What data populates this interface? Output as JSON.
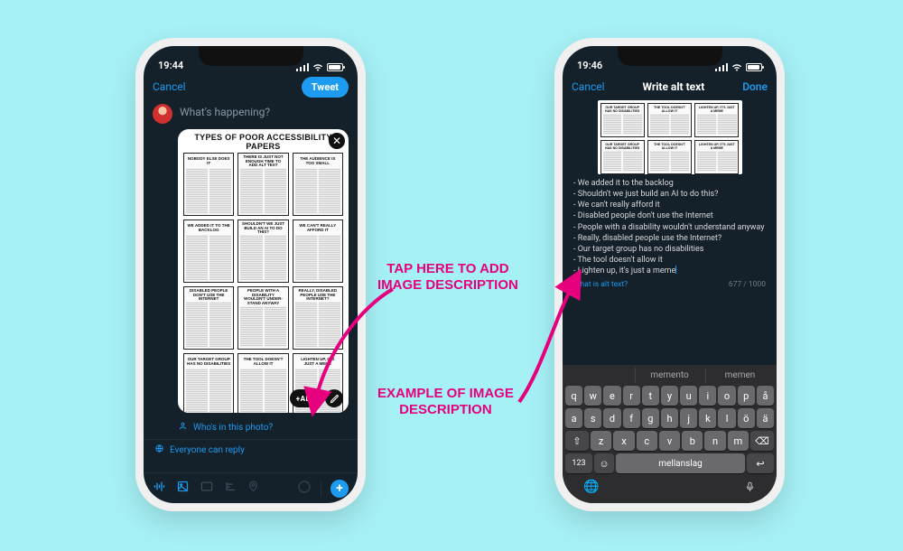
{
  "status": {
    "time_left": "19:44",
    "time_right": "19:46"
  },
  "left_phone": {
    "nav": {
      "cancel": "Cancel",
      "tweet": "Tweet"
    },
    "compose_placeholder": "What's happening?",
    "attachment_title": "TYPES OF POOR ACCESSIBILITY PAPERS",
    "papers": [
      "NOBODY ELSE DOES IT",
      "THERE IS JUST NOT ENOUGH TIME TO ADD ALT TEXT",
      "THE AUDIENCE IS TOO SMALL",
      "WE ADDED IT TO THE BACKLOG",
      "SHOULDN'T WE JUST BUILD AN AI TO DO THIS?",
      "WE CAN'T REALLY AFFORD IT",
      "DISABLED PEOPLE DON'T USE THE INTERNET",
      "PEOPLE WITH A DISABILITY WOULDN'T UNDER-STAND ANYWAY",
      "REALLY, DISABLED PEOPLE USE THE INTERNET?",
      "OUR TARGET GROUP HAS NO DISABILITIES",
      "THE TOOL DOESN'T ALLOW IT",
      "LIGHTEN UP, IT'S JUST A MEME"
    ],
    "alt_button": "+ALT",
    "tag_prompt": "Who's in this photo?",
    "reply_scope": "Everyone can reply"
  },
  "right_phone": {
    "nav": {
      "cancel": "Cancel",
      "title": "Write alt text",
      "done": "Done"
    },
    "preview_papers": [
      "OUR TARGET GROUP HAS NO DISABILITIES",
      "THE TOOL DOESN'T ALLOW IT",
      "LIGHTEN UP, IT'S JUST A MEME",
      "OUR TARGET GROUP HAS NO DISABILITIES",
      "THE TOOL DOESN'T ALLOW IT",
      "LIGHTEN UP, IT'S JUST A MEME"
    ],
    "alt_text_lines": "- We added it to the backlog\n- Shouldn't we just build an AI to do this?\n- We can't really afford it\n- Disabled people don't use the Internet\n- People with a disability wouldn't understand anyway\n- Really, disabled people use the Internet?\n- Our target group has no disabilities\n- The tool doesn't allow it\n- Lighten up, it's just a meme",
    "help_link": "What is alt text?",
    "char_count": "677 / 1000",
    "keyboard": {
      "suggestions": [
        "",
        "memento",
        "memen"
      ],
      "row1": [
        "q",
        "w",
        "e",
        "r",
        "t",
        "y",
        "u",
        "i",
        "o",
        "p",
        "å"
      ],
      "row2": [
        "a",
        "s",
        "d",
        "f",
        "g",
        "h",
        "j",
        "k",
        "l",
        "ö",
        "ä"
      ],
      "row3_keys": [
        "z",
        "x",
        "c",
        "v",
        "b",
        "n",
        "m"
      ],
      "shift": "⇧",
      "backspace": "⌫",
      "numkey": "123",
      "emoji": "☺",
      "space": "mellanslag",
      "return": "↩",
      "globe": "🌐",
      "mic": "🎤"
    }
  },
  "annotations": {
    "tap_here": "TAP HERE TO ADD\nIMAGE DESCRIPTION",
    "example": "EXAMPLE OF IMAGE\nDESCRIPTION"
  }
}
